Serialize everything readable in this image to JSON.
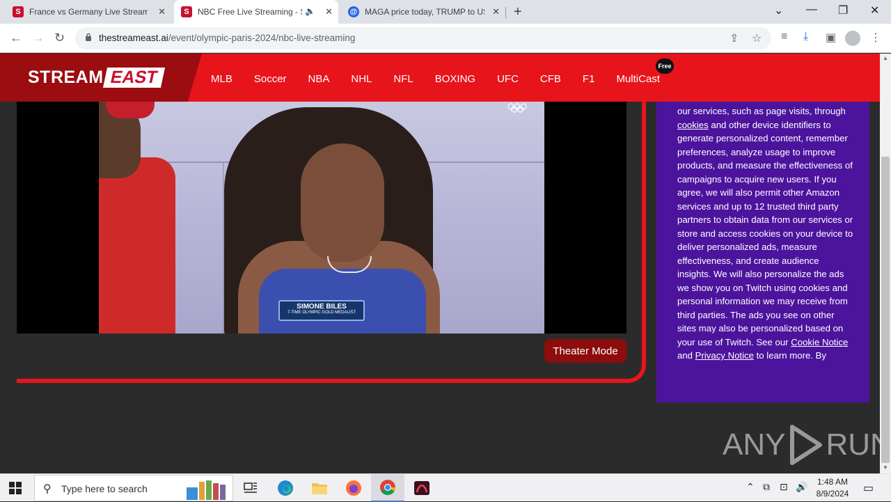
{
  "browser": {
    "tabs": [
      {
        "title": "France vs Germany Live Streaming",
        "favicon": "S",
        "active": false
      },
      {
        "title": "NBC Free Live Streaming - S",
        "favicon": "S",
        "active": true
      },
      {
        "title": "MAGA price today, TRUMP to US",
        "favicon": "@",
        "active": false
      }
    ],
    "url_domain": "thestreameast.ai",
    "url_path": "/event/olympic-paris-2024/nbc-live-streaming"
  },
  "site": {
    "logo_stream": "STREAM",
    "logo_east": "EAST",
    "nav": [
      "MLB",
      "Soccer",
      "NBA",
      "NHL",
      "NFL",
      "BOXING",
      "UFC",
      "CFB",
      "F1",
      "MultiCast"
    ],
    "free_badge": "Free",
    "brand_color": "#e8141b"
  },
  "video": {
    "lower_third_name": "SIMONE BILES",
    "lower_third_sub": "7-TIME OLYMPIC GOLD MEDALIST"
  },
  "player": {
    "theater_button": "Theater Mode"
  },
  "consent": {
    "text_1": "our services, such as page visits, through ",
    "link_cookies": "cookies",
    "text_2": " and other device identifiers to generate personalized content, remember preferences, analyze usage to improve products, and measure the effectiveness of campaigns to acquire new users. If you agree, we will also permit other Amazon services and up to 12 trusted third party partners to obtain data from our services or store and access cookies on your device to deliver personalized ads, measure effectiveness, and create audience insights. We will also personalize the ads we show you on Twitch using cookies and personal information we may receive from third parties. The ads you see on other sites may also be personalized based on your use of Twitch. See our ",
    "link_cookie_notice": "Cookie Notice",
    "text_3": " and ",
    "link_privacy": "Privacy Notice",
    "text_4": " to learn more. By"
  },
  "watermark": {
    "left": "ANY",
    "right": "RUN"
  },
  "taskbar": {
    "search_placeholder": "Type here to search",
    "time": "1:48 AM",
    "date": "8/9/2024"
  }
}
